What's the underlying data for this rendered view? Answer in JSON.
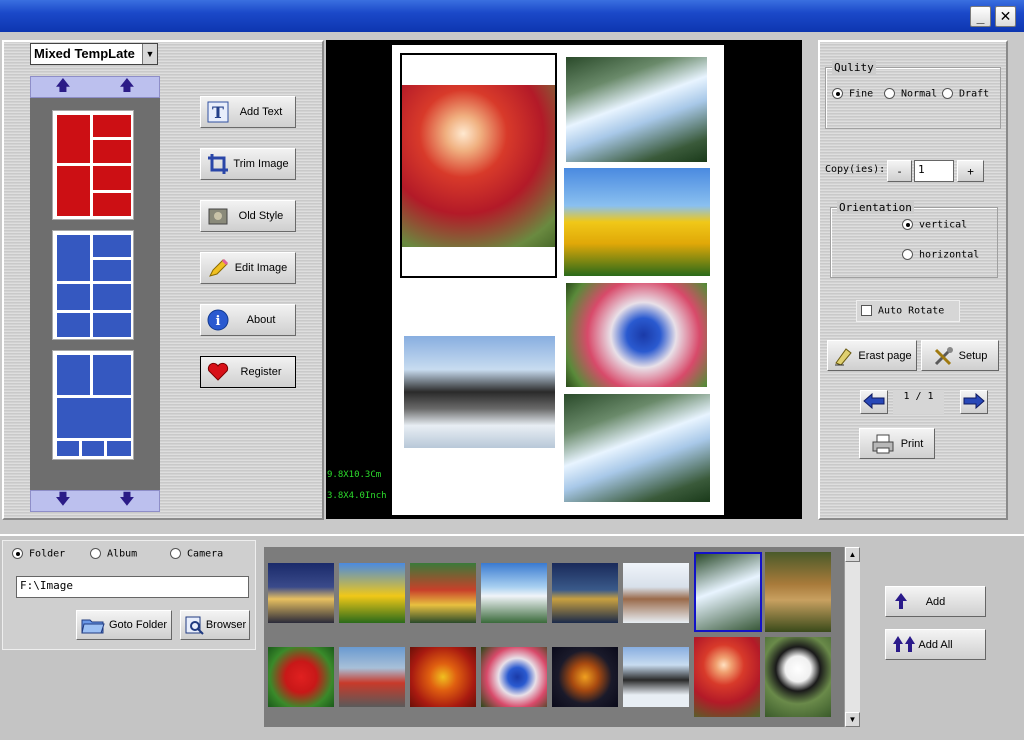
{
  "window": {
    "minimize_label": "_",
    "close_label": "✕"
  },
  "template_select": {
    "value": "Mixed TempLate"
  },
  "actions": {
    "add_text": "Add Text",
    "trim_image": "Trim Image",
    "old_style": "Old Style",
    "edit_image": "Edit Image",
    "about": "About",
    "register": "Register"
  },
  "preview": {
    "size_cm": "9.8X10.3Cm",
    "size_inch": "3.8X4.0Inch"
  },
  "quality": {
    "legend": "Qulity",
    "options": [
      "Fine",
      "Normal",
      "Draft"
    ],
    "selected": "Fine"
  },
  "copies": {
    "label": "Copy(ies):",
    "value": "1",
    "minus": "-",
    "plus": "+"
  },
  "orientation": {
    "legend": "Orientation",
    "vertical": "vertical",
    "horizontal": "horizontal",
    "selected": "vertical"
  },
  "auto_rotate": {
    "label": "Auto Rotate",
    "checked": false
  },
  "erase_page": "Erast page",
  "setup": "Setup",
  "pager": {
    "text": "1 / 1"
  },
  "print": "Print",
  "source": {
    "options": [
      "Folder",
      "Album",
      "Camera"
    ],
    "selected": "Folder"
  },
  "path": {
    "value": "F:\\Image"
  },
  "goto_folder": "Goto Folder",
  "browser": "Browser",
  "add": "Add",
  "add_all": "Add All",
  "colors": {
    "titlebar": "#1b49c9",
    "template_red": "#cc0f14",
    "template_blue": "#3558c0",
    "gallery_bg": "#7c7c7c",
    "selected_border": "#1212c8"
  },
  "thumbnails": [
    "city-night-thumb",
    "tulips-thumb",
    "group-photo-thumb",
    "mountains-thumb",
    "harbor-night-thumb",
    "wolves-thumb",
    "waterfall-thumb",
    "temple-thumb",
    "red-flowers-thumb",
    "race-car-thumb",
    "autumn-leaves-thumb",
    "bluebird-thumb",
    "highway-night-thumb",
    "misty-peaks-thumb",
    "girl-umbrella-thumb",
    "panda-thumb"
  ]
}
